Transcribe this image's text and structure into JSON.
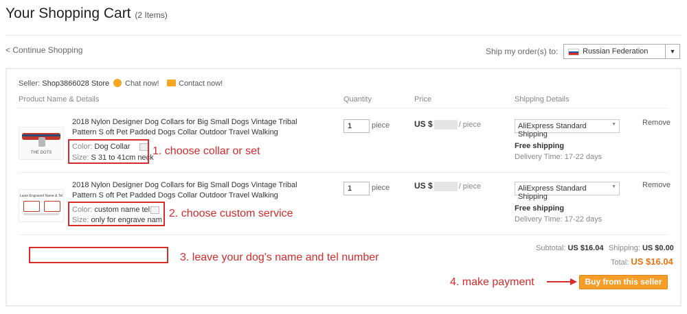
{
  "header": {
    "title": "Your Shopping Cart",
    "item_count": "(2 Items)"
  },
  "nav": {
    "continue": "< Continue Shopping"
  },
  "shipping_dest": {
    "label": "Ship my order(s) to:",
    "country": "Russian Federation"
  },
  "seller": {
    "label": "Seller:",
    "name": "Shop3866028 Store",
    "chat": "Chat now!",
    "contact": "Contact now!"
  },
  "columns": {
    "product": "Product Name & Details",
    "quantity": "Quantity",
    "price": "Price",
    "shipping": "Shipping Details"
  },
  "items": [
    {
      "title": "2018 Nylon Designer Dog Collars for Big Small Dogs Vintage Tribal Pattern S oft Pet Padded Dogs Collar Outdoor Travel Walking",
      "color_label": "Color:",
      "color": "Dog Collar",
      "size_label": "Size:",
      "size": "S 31 to 41cm neck",
      "quantity": "1",
      "unit": "piece",
      "price_prefix": "US $",
      "price_suffix": "/ piece",
      "shipping_method": "AliExpress Standard Shipping",
      "shipping_cost": "Free shipping",
      "delivery": "Delivery Time: 17-22 days",
      "remove": "Remove",
      "image_text": "THE DOTS"
    },
    {
      "title": "2018 Nylon Designer Dog Collars for Big Small Dogs Vintage Tribal Pattern S oft Pet Padded Dogs Collar Outdoor Travel Walking",
      "color_label": "Color:",
      "color": "custom name tel",
      "size_label": "Size:",
      "size": "only for engrave nam",
      "quantity": "1",
      "unit": "piece",
      "price_prefix": "US $",
      "price_suffix": "/ piece",
      "shipping_method": "AliExpress Standard Shipping",
      "shipping_cost": "Free shipping",
      "delivery": "Delivery Time: 17-22 days",
      "remove": "Remove",
      "image_text": "Laser Engraved Name & Tel"
    }
  ],
  "summary": {
    "subtotal_label": "Subtotal:",
    "subtotal": "US $16.04",
    "shipping_label": "Shipping:",
    "shipping": "US $0.00",
    "total_label": "Total:",
    "total": "US $16.04"
  },
  "buy_button": "Buy from this seller",
  "annotations": {
    "step1": "1. choose collar or set",
    "step2": "2. choose custom service",
    "step3": "3. leave your dog's name and tel number",
    "step4": "4. make payment"
  },
  "colors": {
    "annotation_red": "#d42b2b",
    "button_orange": "#f79d2a",
    "total_orange": "#e8740e",
    "icon_orange": "#f5a623"
  }
}
